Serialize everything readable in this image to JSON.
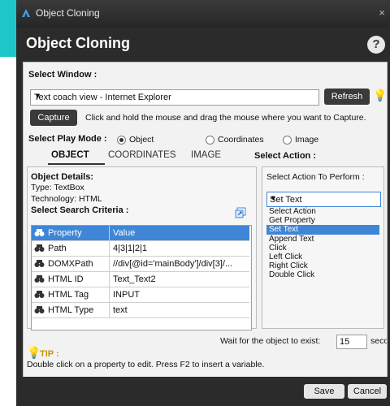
{
  "window": {
    "title": "Object Cloning",
    "close": "×"
  },
  "header": {
    "title": "Object Cloning",
    "help": "?"
  },
  "select_window": {
    "label": "Select Window :",
    "value": "Text coach view - Internet Explorer",
    "refresh": "Refresh",
    "capture": "Capture",
    "capture_hint": "Click and hold the mouse and drag the mouse where you want to Capture."
  },
  "play_mode": {
    "label": "Select Play Mode :",
    "options": [
      "Object",
      "Coordinates",
      "Image"
    ],
    "selected": "Object"
  },
  "tabs": [
    "OBJECT",
    "COORDINATES",
    "IMAGE"
  ],
  "object_details": {
    "heading": "Object Details:",
    "type": "Type:  TextBox",
    "technology": "Technology:  HTML",
    "criteria_label": "Select Search Criteria :"
  },
  "grid": {
    "columns": [
      "Property",
      "Value"
    ],
    "rows": [
      [
        "Path",
        "4|3|1|2|1"
      ],
      [
        "DOMXPath",
        "//div[@id='mainBody']/div[3]/..."
      ],
      [
        "HTML ID",
        "Text_Text2"
      ],
      [
        "HTML Tag",
        "INPUT"
      ],
      [
        "HTML Type",
        "text"
      ]
    ]
  },
  "action": {
    "section": "Select Action :",
    "label": "Select Action To Perform :",
    "value": "Set Text",
    "options": [
      "Select Action",
      "Get Property",
      "Set Text",
      "Append Text",
      "Click",
      "Left Click",
      "Right Click",
      "Double Click"
    ],
    "selected_index": 2
  },
  "wait": {
    "label": "Wait for the object to exist:",
    "value": "15",
    "unit": "seconds"
  },
  "tip": {
    "label": "TIP :",
    "text": "Double click on a property to edit. Press F2 to insert a variable."
  },
  "footer": {
    "save": "Save",
    "cancel": "Cancel"
  },
  "colors": {
    "accent": "#3f86d6",
    "teal": "#1ec6c9",
    "dark": "#2b2b2b",
    "bulb": "#f5c400"
  }
}
